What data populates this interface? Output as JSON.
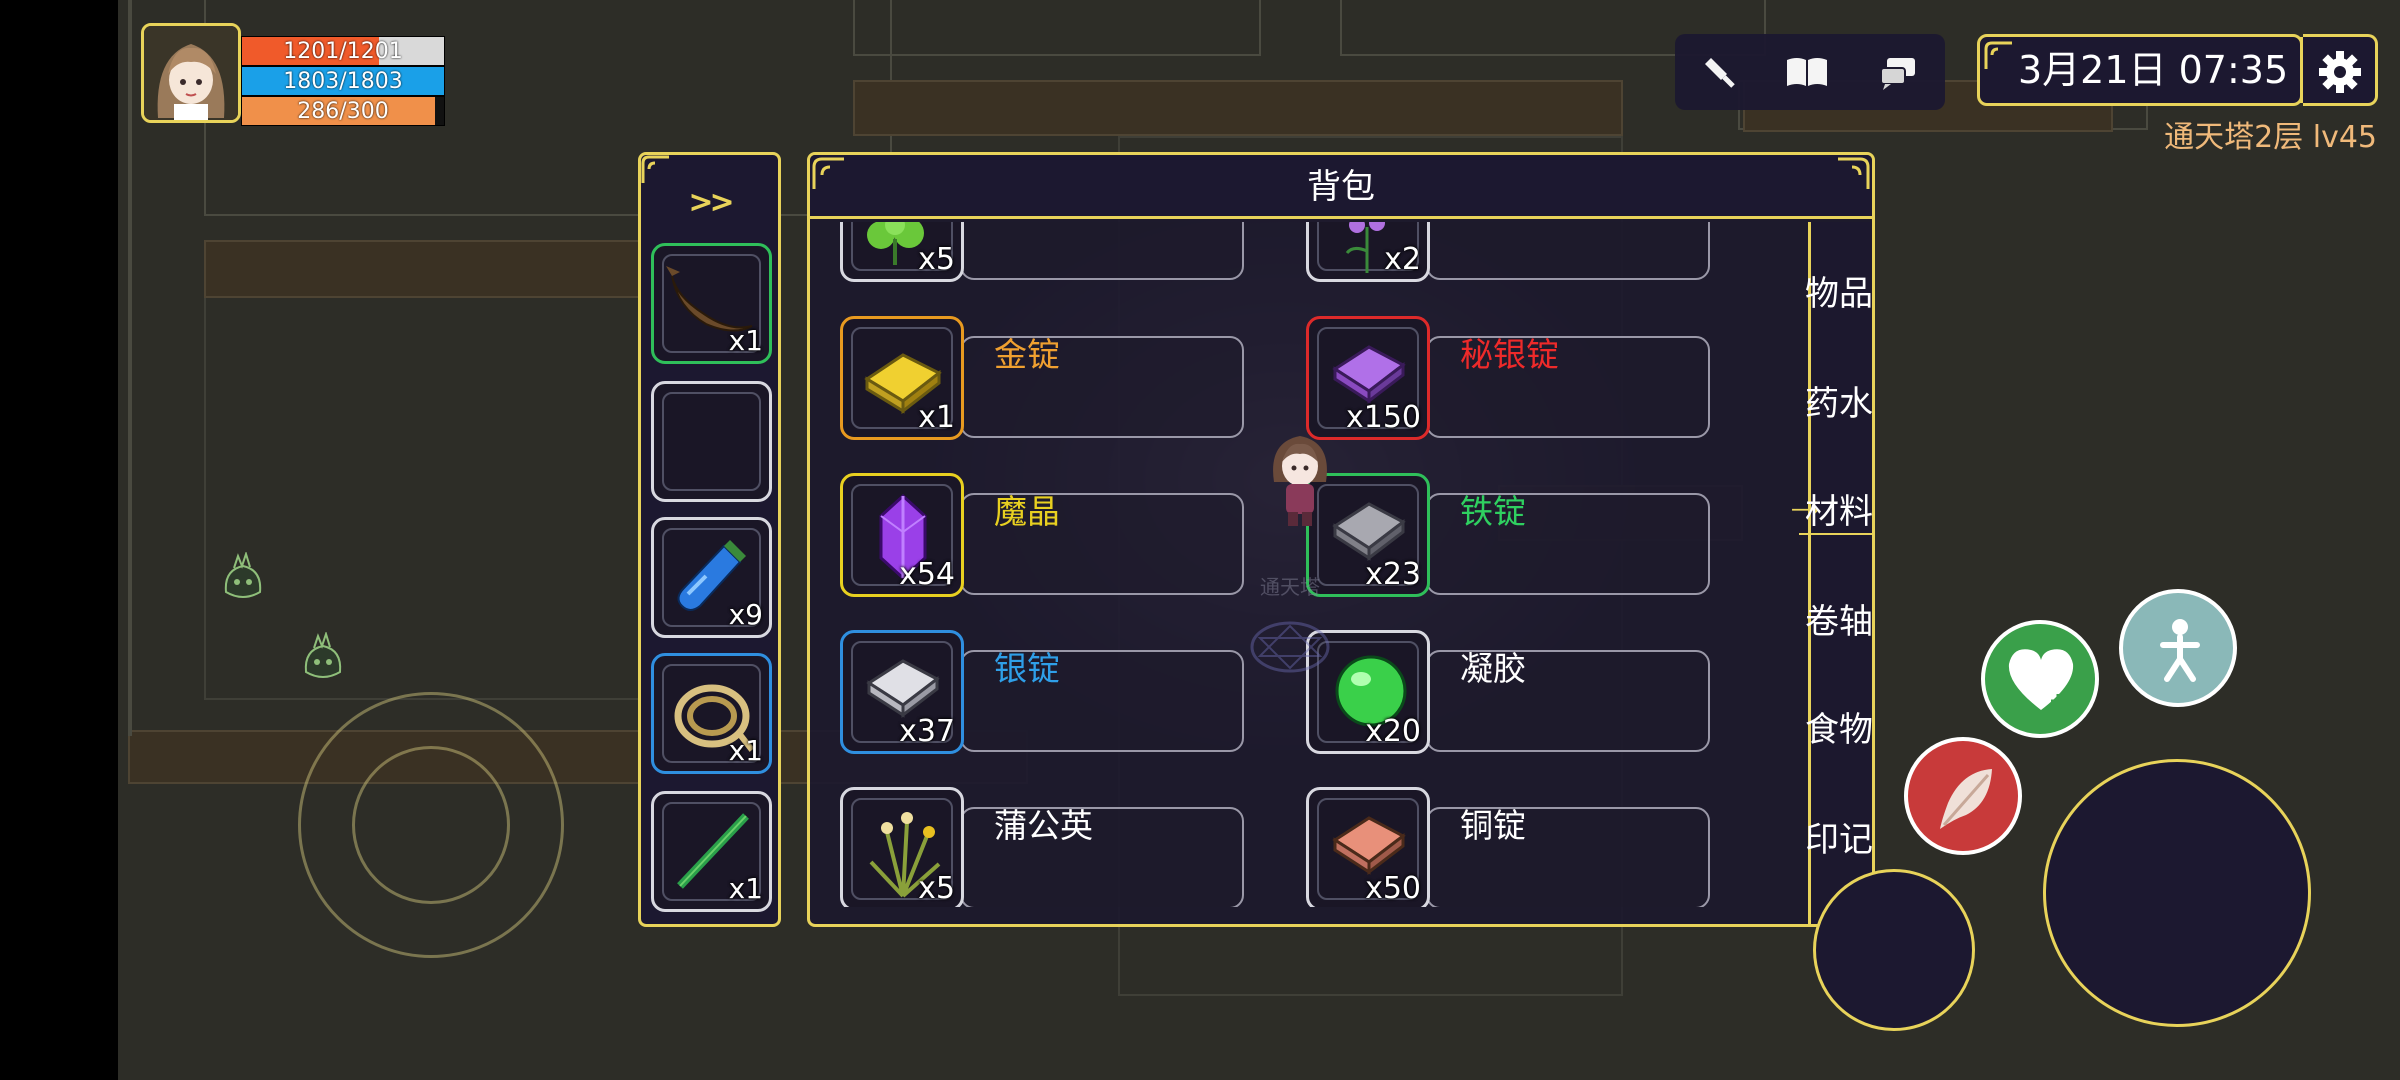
{
  "hud": {
    "hp": "1201/1201",
    "hp_frac": 1.0,
    "mp": "1803/1803",
    "mp_frac": 1.0,
    "xp": "286/300",
    "xp_frac": 0.953
  },
  "toolbar": {
    "icons": [
      "hammer-icon",
      "book-icon",
      "chat-icon"
    ]
  },
  "clock": {
    "date_time": "3月21日  07:35"
  },
  "location": {
    "floor": "通天塔2层  lv45"
  },
  "quickbar": {
    "toggle": ">>",
    "slots": [
      {
        "icon": "fish-icon",
        "count": "x1",
        "border": "#2fbf5a"
      },
      {
        "icon": "",
        "count": "",
        "border": "#d8d8e0"
      },
      {
        "icon": "blue-potion-icon",
        "count": "x9",
        "border": "#d8d8e0"
      },
      {
        "icon": "rope-icon",
        "count": "x1",
        "border": "#2f8fe0"
      },
      {
        "icon": "bamboo-icon",
        "count": "x1",
        "border": "#d8d8e0"
      }
    ]
  },
  "bag": {
    "title": "背包",
    "items": [
      {
        "name": "",
        "count": "x5",
        "color": "#ffffff",
        "border": "#d8d8e0",
        "icon": "herb-icon"
      },
      {
        "name": "",
        "count": "x2",
        "color": "#ffffff",
        "border": "#d8d8e0",
        "icon": "flower-icon"
      },
      {
        "name": "金锭",
        "count": "x1",
        "color": "#f0a030",
        "border": "#e89a20",
        "icon": "gold-ingot-icon"
      },
      {
        "name": "秘银锭",
        "count": "x150",
        "color": "#ee2a2a",
        "border": "#dd2a2a",
        "icon": "mithril-ingot-icon"
      },
      {
        "name": "魔晶",
        "count": "x54",
        "color": "#e8d020",
        "border": "#e8d020",
        "icon": "purple-crystal-icon"
      },
      {
        "name": "铁锭",
        "count": "x23",
        "color": "#2fd060",
        "border": "#2fbf5a",
        "icon": "iron-ingot-icon"
      },
      {
        "name": "银锭",
        "count": "x37",
        "color": "#2f9fe8",
        "border": "#2f8fe0",
        "icon": "silver-ingot-icon"
      },
      {
        "name": "凝胶",
        "count": "x20",
        "color": "#ffffff",
        "border": "#d8d8e0",
        "icon": "gel-icon"
      },
      {
        "name": "蒲公英",
        "count": "x5",
        "color": "#ffffff",
        "border": "#d8d8e0",
        "icon": "dandelion-icon"
      },
      {
        "name": "铜锭",
        "count": "x50",
        "color": "#ffffff",
        "border": "#d8d8e0",
        "icon": "copper-ingot-icon"
      }
    ],
    "tabs": [
      "物品",
      "药水",
      "材料",
      "卷轴",
      "食物",
      "印记"
    ],
    "active_tab": "材料"
  },
  "world": {
    "watermark": "通天塔"
  },
  "colors": {
    "accent": "#e8d35a",
    "panel": "#1c1830",
    "hp": "#f05a2a",
    "mp": "#1aa0e8",
    "xp": "#f0904a"
  }
}
